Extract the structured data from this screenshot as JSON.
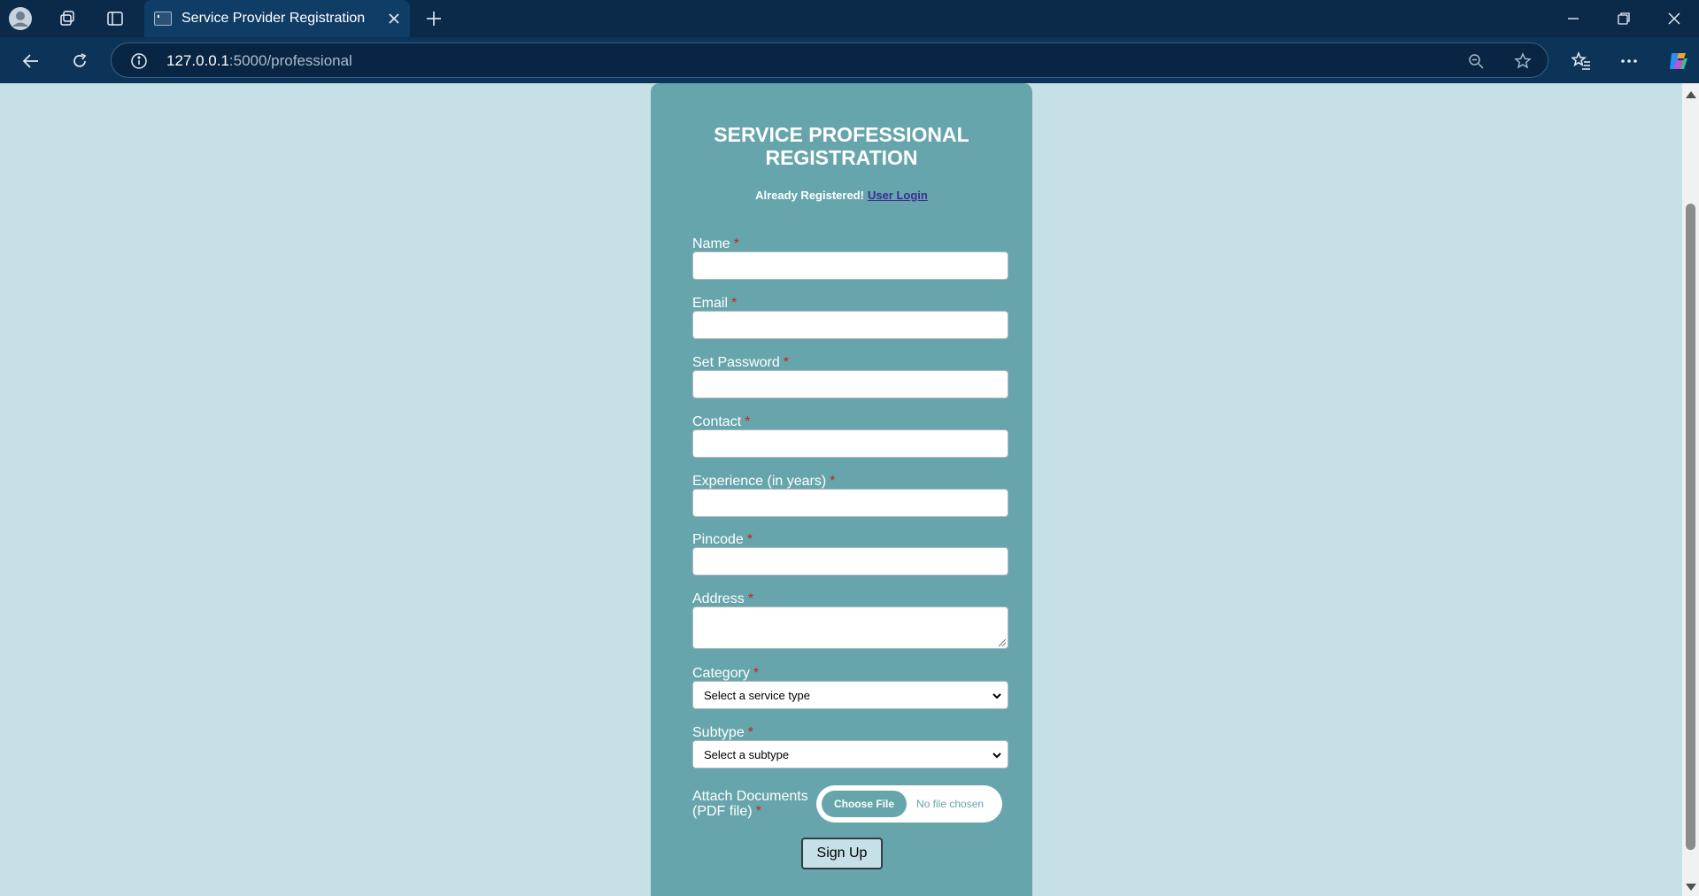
{
  "browser": {
    "tab_title": "Service Provider Registration",
    "url_host": "127.0.0.1",
    "url_path": ":5000/professional",
    "theme_color": "#0b2a4a"
  },
  "form": {
    "title": "SERVICE PROFESSIONAL REGISTRATION",
    "already_text": "Already Registered!",
    "login_link": "User Login",
    "required_mark": "*",
    "fields": {
      "name": "Name",
      "email": "Email",
      "password": "Set Password",
      "contact": "Contact",
      "experience": "Experience (in years)",
      "pincode": "Pincode",
      "address": "Address",
      "category": "Category",
      "subtype": "Subtype"
    },
    "category_selected": "Select a service type",
    "subtype_selected": "Select a subtype",
    "attach_label_line1": "Attach Documents",
    "attach_label_line2": "(PDF file)",
    "choose_file": "Choose File",
    "no_file": "No file chosen",
    "submit": "Sign Up",
    "card_color": "#67a5ad",
    "page_color": "#c5e0e6"
  }
}
